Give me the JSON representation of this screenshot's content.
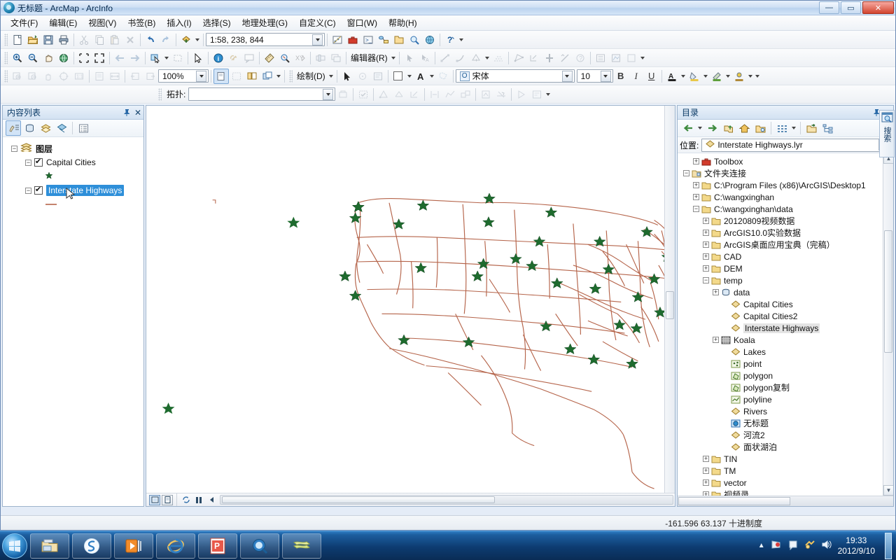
{
  "window": {
    "title": "无标题 - ArcMap - ArcInfo",
    "app_icon": "arcmap-globe-icon",
    "minimize": "—",
    "maximize": "▭",
    "close": "✕"
  },
  "menubar": {
    "items": [
      {
        "label": "文件(F)",
        "name": "menu-file"
      },
      {
        "label": "编辑(E)",
        "name": "menu-edit"
      },
      {
        "label": "视图(V)",
        "name": "menu-view"
      },
      {
        "label": "书签(B)",
        "name": "menu-bookmarks"
      },
      {
        "label": "插入(I)",
        "name": "menu-insert"
      },
      {
        "label": "选择(S)",
        "name": "menu-selection"
      },
      {
        "label": "地理处理(G)",
        "name": "menu-geoprocessing"
      },
      {
        "label": "自定义(C)",
        "name": "menu-customize"
      },
      {
        "label": "窗口(W)",
        "name": "menu-window"
      },
      {
        "label": "帮助(H)",
        "name": "menu-help"
      }
    ]
  },
  "standard_toolbar": {
    "scale_value": "1:58, 238, 844",
    "buttons": [
      "new-document-icon",
      "open-folder-icon",
      "save-icon",
      "print-icon",
      "cut-icon",
      "copy-icon",
      "paste-icon",
      "delete-icon",
      "undo-icon",
      "redo-icon",
      "add-data-icon"
    ]
  },
  "tools_toolbar": {
    "buttons": [
      "zoom-in-icon",
      "zoom-out-icon",
      "pan-icon",
      "full-extent-icon",
      "fixed-zoom-in-icon",
      "fixed-zoom-out-icon",
      "back-extent-icon",
      "forward-extent-icon",
      "select-features-icon",
      "clear-selection-icon",
      "select-elements-icon",
      "identify-icon",
      "hyperlink-icon",
      "html-popup-icon",
      "measure-icon",
      "find-icon",
      "go-to-xy-icon",
      "time-slider-icon",
      "create-viewer-window-icon"
    ]
  },
  "editor_toolbar": {
    "menu_label": "编辑器(R)",
    "buttons": [
      "edit-tool-icon",
      "edit-annotation-icon",
      "straight-segment-icon",
      "curve-segment-icon",
      "construction-tools-icon",
      "trace-icon",
      "edit-vertices-icon",
      "reshape-icon",
      "split-icon",
      "rotate-icon",
      "attributes-icon",
      "sketch-properties-icon",
      "create-features-icon"
    ]
  },
  "layout_toolbar": {
    "zoom_value": "100%",
    "buttons": [
      "layout-zoom-in-icon",
      "layout-zoom-out-icon",
      "layout-pan-icon",
      "layout-full-extent-icon",
      "layout-1to1-icon",
      "zoom-whole-page-icon",
      "zoom-page-width-icon",
      "go-back-layout-icon",
      "go-forward-layout-icon",
      "toggle-draft-mode-icon",
      "focus-data-frame-icon",
      "change-layout-icon",
      "data-driven-pages-icon"
    ]
  },
  "draw_toolbar": {
    "menu_label": "绘制(D)",
    "font_name": "宋体",
    "font_size": "10",
    "bold": "B",
    "italic": "I",
    "underline": "U",
    "buttons": [
      "select-elements-icon",
      "rotate-element-icon",
      "new-rectangle-icon",
      "fill-color-icon",
      "font-color-icon",
      "line-color-icon",
      "marker-color-icon"
    ]
  },
  "topology_toolbar": {
    "label": "拓扑:",
    "dropdown_value": "",
    "buttons": [
      "select-topology-icon",
      "validate-topology-icon",
      "topology-edit-tool-icon",
      "modify-edge-icon",
      "reshape-edge-icon",
      "align-edge-icon",
      "generalize-edge-icon",
      "shared-features-icon",
      "construct-features-icon",
      "planarize-lines-icon",
      "validate-selected-icon",
      "error-inspector-icon"
    ]
  },
  "toc": {
    "title": "内容列表",
    "pin": "pin-icon",
    "close": "✕",
    "toolbar_buttons": [
      "list-by-drawing-order-icon",
      "list-by-source-icon",
      "list-by-visibility-icon",
      "list-by-selection-icon",
      "options-icon"
    ],
    "root": "图层",
    "layers": [
      {
        "name": "Capital Cities",
        "checked": true,
        "selected": false,
        "symbol": "green-star"
      },
      {
        "name": "Interstate Highways",
        "checked": true,
        "selected": true,
        "symbol": "brown-line"
      }
    ]
  },
  "map": {
    "vertical_scrollbar": "map-vertical-scrollbar",
    "horizontal_scrollbar": "map-horizontal-scrollbar",
    "bottom_buttons": [
      "data-view-icon",
      "layout-view-icon",
      "refresh-view-icon",
      "pause-drawing-icon",
      "previous-extent-icon"
    ],
    "highway_color": "#b5543a",
    "city_symbol_color": "#1e6b2e"
  },
  "catalog": {
    "title": "目录",
    "pin": "pin-icon",
    "close": "✕",
    "toolbar_buttons": [
      "back-icon",
      "forward-icon",
      "up-one-level-icon",
      "home-icon",
      "default-geodatabase-icon",
      "toggle-contents-panel-icon",
      "connect-to-folder-icon",
      "toggle-tree-view-icon"
    ],
    "location_label": "位置:",
    "location_value": "Interstate Highways.lyr",
    "tree": [
      {
        "label": "Toolbox",
        "indent": 1,
        "expander": "+",
        "icon": "toolbox-icon"
      },
      {
        "label": "文件夹连接",
        "indent": 0,
        "expander": "-",
        "icon": "folder-connections-icon"
      },
      {
        "label": "C:\\Program Files (x86)\\ArcGIS\\Desktop1",
        "indent": 1,
        "expander": "+",
        "icon": "folder-icon"
      },
      {
        "label": "C:\\wangxinghan",
        "indent": 1,
        "expander": "+",
        "icon": "folder-icon"
      },
      {
        "label": "C:\\wangxinghan\\data",
        "indent": 1,
        "expander": "-",
        "icon": "folder-icon"
      },
      {
        "label": "20120809视频数据",
        "indent": 2,
        "expander": "+",
        "icon": "folder-icon"
      },
      {
        "label": "ArcGIS10.0实验数据",
        "indent": 2,
        "expander": "+",
        "icon": "folder-icon"
      },
      {
        "label": "ArcGIS桌面应用宝典（完稿）",
        "indent": 2,
        "expander": "+",
        "icon": "folder-icon"
      },
      {
        "label": "CAD",
        "indent": 2,
        "expander": "+",
        "icon": "folder-icon"
      },
      {
        "label": "DEM",
        "indent": 2,
        "expander": "+",
        "icon": "folder-icon"
      },
      {
        "label": "temp",
        "indent": 2,
        "expander": "-",
        "icon": "folder-icon"
      },
      {
        "label": "data",
        "indent": 3,
        "expander": "+",
        "icon": "geodatabase-icon"
      },
      {
        "label": "Capital Cities",
        "indent": 4,
        "expander": "",
        "icon": "layer-file-icon"
      },
      {
        "label": "Capital Cities2",
        "indent": 4,
        "expander": "",
        "icon": "layer-file-icon"
      },
      {
        "label": "Interstate Highways",
        "indent": 4,
        "expander": "",
        "icon": "layer-file-icon",
        "highlighted": true
      },
      {
        "label": "Koala",
        "indent": 3,
        "expander": "+",
        "icon": "raster-icon"
      },
      {
        "label": "Lakes",
        "indent": 4,
        "expander": "",
        "icon": "layer-file-icon"
      },
      {
        "label": "point",
        "indent": 4,
        "expander": "",
        "icon": "point-shapefile-icon"
      },
      {
        "label": "polygon",
        "indent": 4,
        "expander": "",
        "icon": "polygon-shapefile-icon"
      },
      {
        "label": "polygon复制",
        "indent": 4,
        "expander": "",
        "icon": "polygon-shapefile-icon"
      },
      {
        "label": "polyline",
        "indent": 4,
        "expander": "",
        "icon": "polyline-shapefile-icon"
      },
      {
        "label": "Rivers",
        "indent": 4,
        "expander": "",
        "icon": "layer-file-icon"
      },
      {
        "label": "无标题",
        "indent": 4,
        "expander": "",
        "icon": "map-document-icon"
      },
      {
        "label": "河流2",
        "indent": 4,
        "expander": "",
        "icon": "layer-file-icon"
      },
      {
        "label": "面状湖泊",
        "indent": 4,
        "expander": "",
        "icon": "layer-file-icon"
      },
      {
        "label": "TIN",
        "indent": 2,
        "expander": "+",
        "icon": "folder-icon"
      },
      {
        "label": "TM",
        "indent": 2,
        "expander": "+",
        "icon": "folder-icon"
      },
      {
        "label": "vector",
        "indent": 2,
        "expander": "+",
        "icon": "folder-icon"
      },
      {
        "label": "视频录",
        "indent": 2,
        "expander": "+",
        "icon": "folder-icon"
      }
    ]
  },
  "search_tab": {
    "label": "搜索",
    "icon": "search-window-icon"
  },
  "statusbar": {
    "coordinates": "-161.596  63.137 十进制度"
  },
  "taskbar": {
    "start": "windows-start-orb",
    "items": [
      "windows-explorer-icon",
      "sogou-input-icon",
      "media-player-icon",
      "internet-explorer-icon",
      "powerpoint-icon",
      "arccatalog-icon",
      "arcmap-icon"
    ],
    "tray": [
      "show-hidden-icons-arrow",
      "network-flag-icon",
      "action-center-icon",
      "input-method-icon",
      "volume-icon"
    ],
    "time": "19:33",
    "date": "2012/9/10"
  }
}
